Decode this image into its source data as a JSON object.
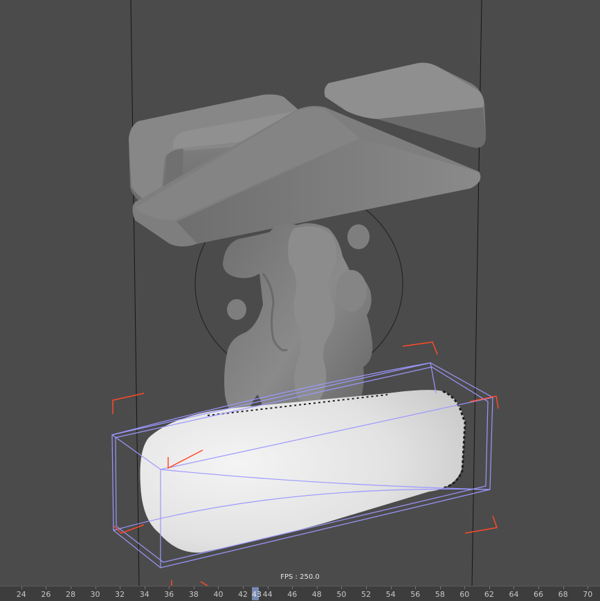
{
  "viewport": {
    "fps_label": "FPS : 250.0"
  },
  "timeline": {
    "frames": [
      "24",
      "26",
      "28",
      "30",
      "32",
      "34",
      "36",
      "38",
      "40",
      "42",
      "44",
      "46",
      "48",
      "50",
      "52",
      "54",
      "56",
      "58",
      "60",
      "62",
      "64",
      "66",
      "68",
      "70"
    ],
    "current_frame": "43",
    "frame_start": 23,
    "frame_end": 71
  },
  "colors": {
    "viewport_bg": "#4b4b4b",
    "mesh_gray": "#7a7a7a",
    "fluid_white": "#e4e4e4",
    "bbox_line": "#9c98ff",
    "gizmo_red": "#ff4a2a",
    "playhead": "#7f96c8"
  }
}
